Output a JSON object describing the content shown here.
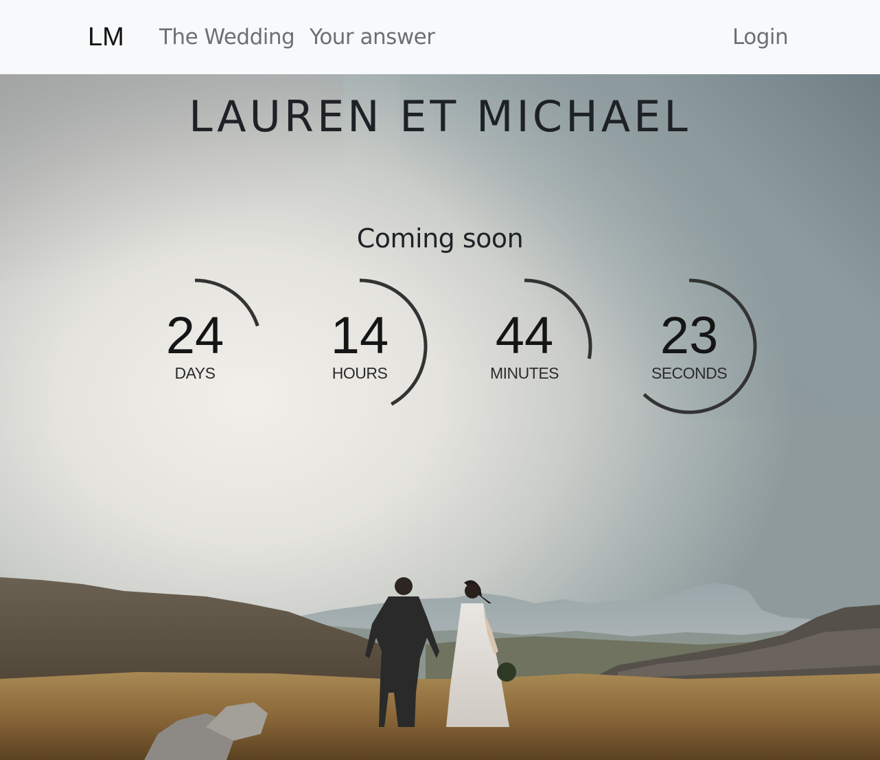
{
  "navbar": {
    "brand": "LM",
    "links": [
      {
        "label": "The Wedding"
      },
      {
        "label": "Your answer"
      }
    ],
    "login": "Login"
  },
  "hero": {
    "title": "LAUREN ET MICHAEL",
    "subtitle": "Coming soon"
  },
  "countdown": [
    {
      "value": "24",
      "label": "DAYS",
      "progress": 0.2
    },
    {
      "value": "14",
      "label": "HOURS",
      "progress": 0.42
    },
    {
      "value": "44",
      "label": "MINUTES",
      "progress": 0.28
    },
    {
      "value": "23",
      "label": "SECONDS",
      "progress": 0.62
    }
  ],
  "colors": {
    "navbar_bg": "#f8f9fa",
    "nav_link": "#6c6f73",
    "ring": "#333333",
    "text_dark": "#1e2226"
  }
}
